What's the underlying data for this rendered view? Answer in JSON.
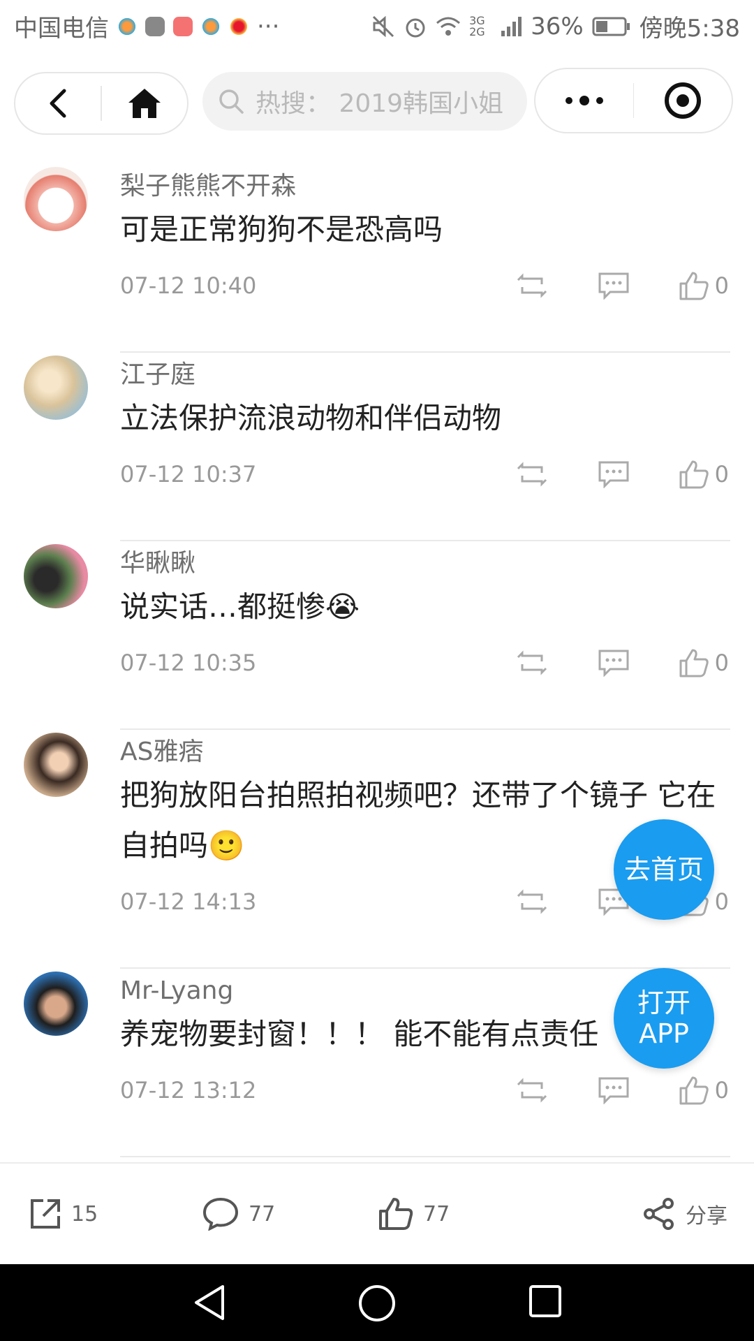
{
  "status_bar": {
    "carrier": "中国电信",
    "more": "···",
    "network": "3G 2G",
    "battery": "36%",
    "time": "傍晚5:38"
  },
  "top_bar": {
    "search_placeholder": "热搜：  2019韩国小姐"
  },
  "comments": [
    {
      "name": "梨子熊熊不开森",
      "text": "可是正常狗狗不是恐高吗",
      "time": "07-12 10:40",
      "likes": "0"
    },
    {
      "name": "江子庭",
      "text": "立法保护流浪动物和伴侣动物",
      "time": "07-12 10:37",
      "likes": "0"
    },
    {
      "name": "华瞅瞅",
      "text": "说实话…都挺惨😭",
      "time": "07-12 10:35",
      "likes": "0"
    },
    {
      "name": "AS雅痞",
      "text": "把狗放阳台拍照拍视频吧？还带了个镜子 它在自拍吗🙂",
      "time": "07-12 14:13",
      "likes": "0"
    },
    {
      "name": "Mr-Lyang",
      "text": "养宠物要封窗！！！ 能不能有点责任",
      "time": "07-12 13:12",
      "likes": "0"
    }
  ],
  "fab": {
    "home_label": "去首页",
    "open_app_line1": "打开",
    "open_app_line2": "APP"
  },
  "bottom_bar": {
    "repost_count": "15",
    "comment_count": "77",
    "like_count": "77",
    "share_label": "分享"
  },
  "colors": {
    "accent": "#1a9cf0",
    "text_primary": "#222222",
    "text_secondary": "#999999"
  }
}
